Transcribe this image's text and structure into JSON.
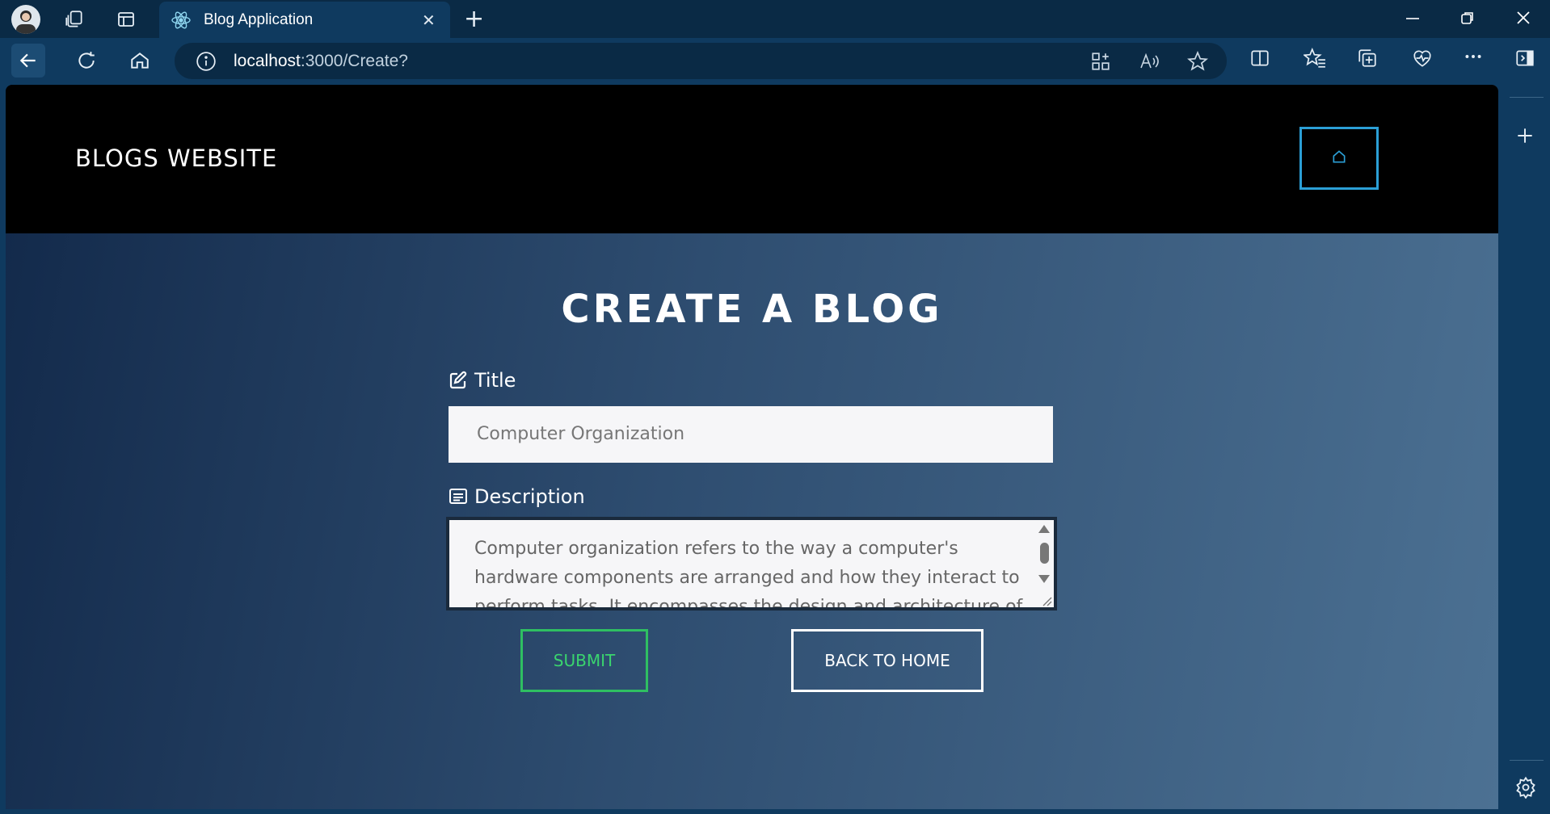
{
  "browser": {
    "tab_title": "Blog Application",
    "url_host": "localhost",
    "url_path": ":3000/Create?",
    "tab_close": "✕",
    "new_tab": "+"
  },
  "site": {
    "brand": "BLOGS WEBSITE",
    "home_icon": "home-icon"
  },
  "form": {
    "heading": "CREATE A BLOG",
    "title_label": "Title",
    "title_value": "Computer Organization",
    "description_label": "Description",
    "description_value": "Computer organization refers to the way a computer's hardware components are arranged and how they interact to perform tasks. It encompasses the design and architecture of",
    "submit_label": "SUBMIT",
    "back_label": "BACK TO HOME"
  },
  "colors": {
    "header_bg": "#000000",
    "home_btn_border": "#2b9fd6",
    "submit_color": "#3ad46e",
    "browser_frame": "#0f3a5f"
  }
}
